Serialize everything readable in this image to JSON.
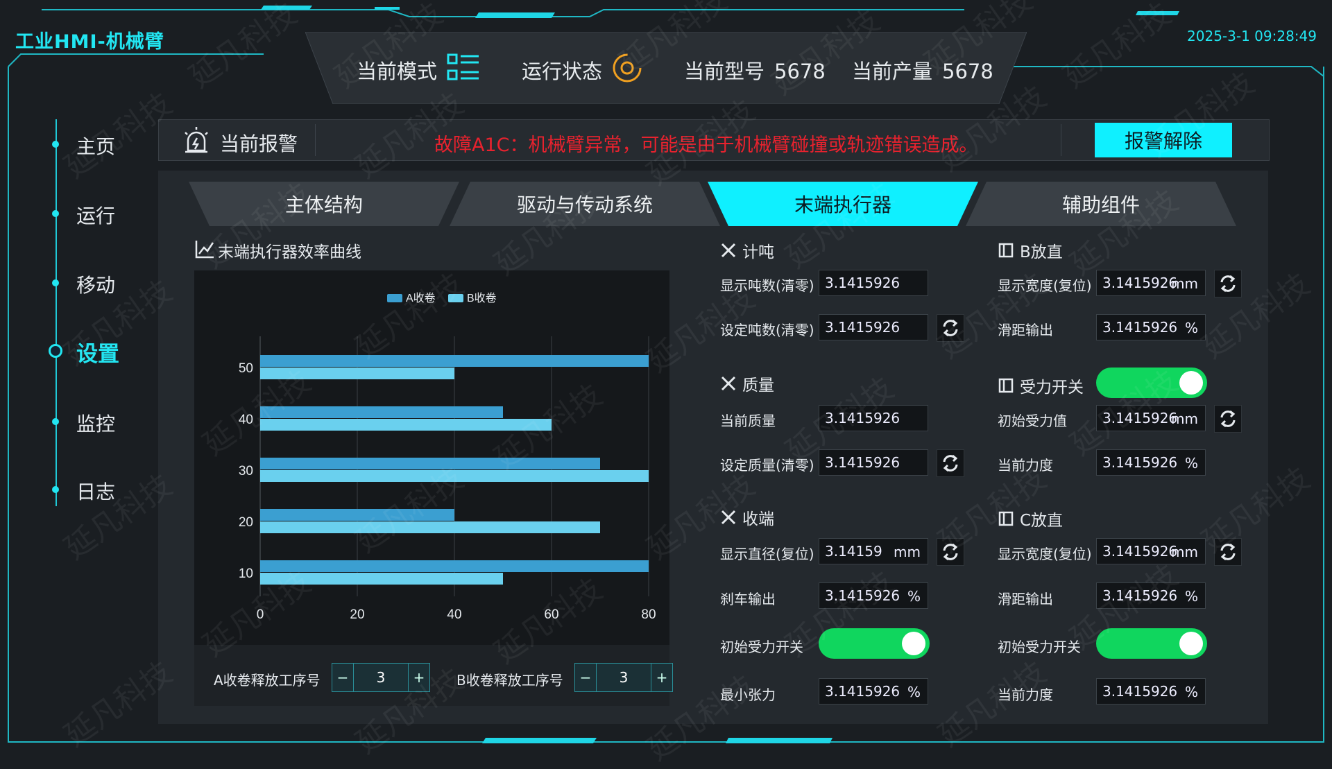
{
  "app": {
    "title": "工业HMI-机械臂",
    "datetime": "2025-3-1  09:28:49"
  },
  "status": {
    "mode_label": "当前模式",
    "run_label": "运行状态",
    "model_label": "当前型号",
    "model_value": "5678",
    "output_label": "当前产量",
    "output_value": "5678"
  },
  "nav": {
    "items": [
      {
        "label": "主页"
      },
      {
        "label": "运行"
      },
      {
        "label": "移动"
      },
      {
        "label": "设置"
      },
      {
        "label": "监控"
      },
      {
        "label": "日志"
      }
    ],
    "active": "设置"
  },
  "alarm": {
    "title": "当前报警",
    "message": "故障A1C：机械臂异常，可能是由于机械臂碰撞或轨迹错误造成。",
    "clear_label": "报警解除"
  },
  "tabs": [
    {
      "label": "主体结构"
    },
    {
      "label": "驱动与传动系统"
    },
    {
      "label": "末端执行器"
    },
    {
      "label": "辅助组件"
    }
  ],
  "active_tab": "末端执行器",
  "chart_title": "末端执行器效率曲线",
  "chart_data": {
    "type": "bar",
    "orientation": "horizontal",
    "categories": [
      "10",
      "20",
      "30",
      "40",
      "50"
    ],
    "series": [
      {
        "name": "A收卷",
        "values": [
          80,
          40,
          70,
          50,
          80
        ]
      },
      {
        "name": "B收卷",
        "values": [
          50,
          70,
          80,
          60,
          40
        ]
      }
    ],
    "xlim": [
      0,
      80
    ],
    "xticks": [
      "0",
      "20",
      "40",
      "60",
      "80"
    ],
    "legend": "top-center",
    "colors": {
      "A收卷": "#3b9fd1",
      "B收卷": "#6ad0ee"
    },
    "grid": true
  },
  "steppers": [
    {
      "label": "A收卷释放工序号",
      "value": "3",
      "minus": "−",
      "plus": "+"
    },
    {
      "label": "B收卷释放工序号",
      "value": "3",
      "minus": "−",
      "plus": "+"
    }
  ],
  "groups": {
    "count": {
      "title": "计吨",
      "rows": [
        {
          "label": "显示吨数(清零)",
          "value": "3.1415926"
        },
        {
          "label": "设定吨数(清零)",
          "value": "3.1415926"
        }
      ]
    },
    "mass": {
      "title": "质量",
      "rows": [
        {
          "label": "当前质量",
          "value": "3.1415926"
        },
        {
          "label": "设定质量(清零)",
          "value": "3.1415926"
        }
      ]
    },
    "winding": {
      "title": "收端",
      "rows": [
        {
          "label": "显示直径(复位)",
          "value": "3.14159",
          "unit": "mm"
        },
        {
          "label": "刹车输出",
          "value": "3.1415926",
          "unit": "%"
        },
        {
          "label": "初始受力开关",
          "toggle": "on"
        },
        {
          "label": "最小张力",
          "value": "3.1415926",
          "unit": "%"
        }
      ]
    },
    "b_flat": {
      "title": "B放直",
      "rows": [
        {
          "label": "显示宽度(复位)",
          "value": "3.1415926",
          "unit": "mm"
        },
        {
          "label": "滑距输出",
          "value": "3.1415926",
          "unit": "%"
        }
      ]
    },
    "force": {
      "title": "受力开关",
      "rows": [
        {
          "label": "初始受力值",
          "value": "3.1415926",
          "unit": "mm"
        },
        {
          "label": "当前力度",
          "value": "3.1415926",
          "unit": "%"
        }
      ]
    },
    "c_flat": {
      "title": "C放直",
      "rows": [
        {
          "label": "显示宽度(复位)",
          "value": "3.1415926",
          "unit": "mm"
        },
        {
          "label": "滑距输出",
          "value": "3.1415926",
          "unit": "%"
        },
        {
          "label": "初始受力开关",
          "toggle": "on"
        },
        {
          "label": "当前力度",
          "value": "3.1415926",
          "unit": "%"
        }
      ]
    }
  },
  "watermark": "延凡科技",
  "colors": {
    "accent": "#22e6f2",
    "alarm": "#e8222e",
    "toggle_on": "#10d65e"
  }
}
